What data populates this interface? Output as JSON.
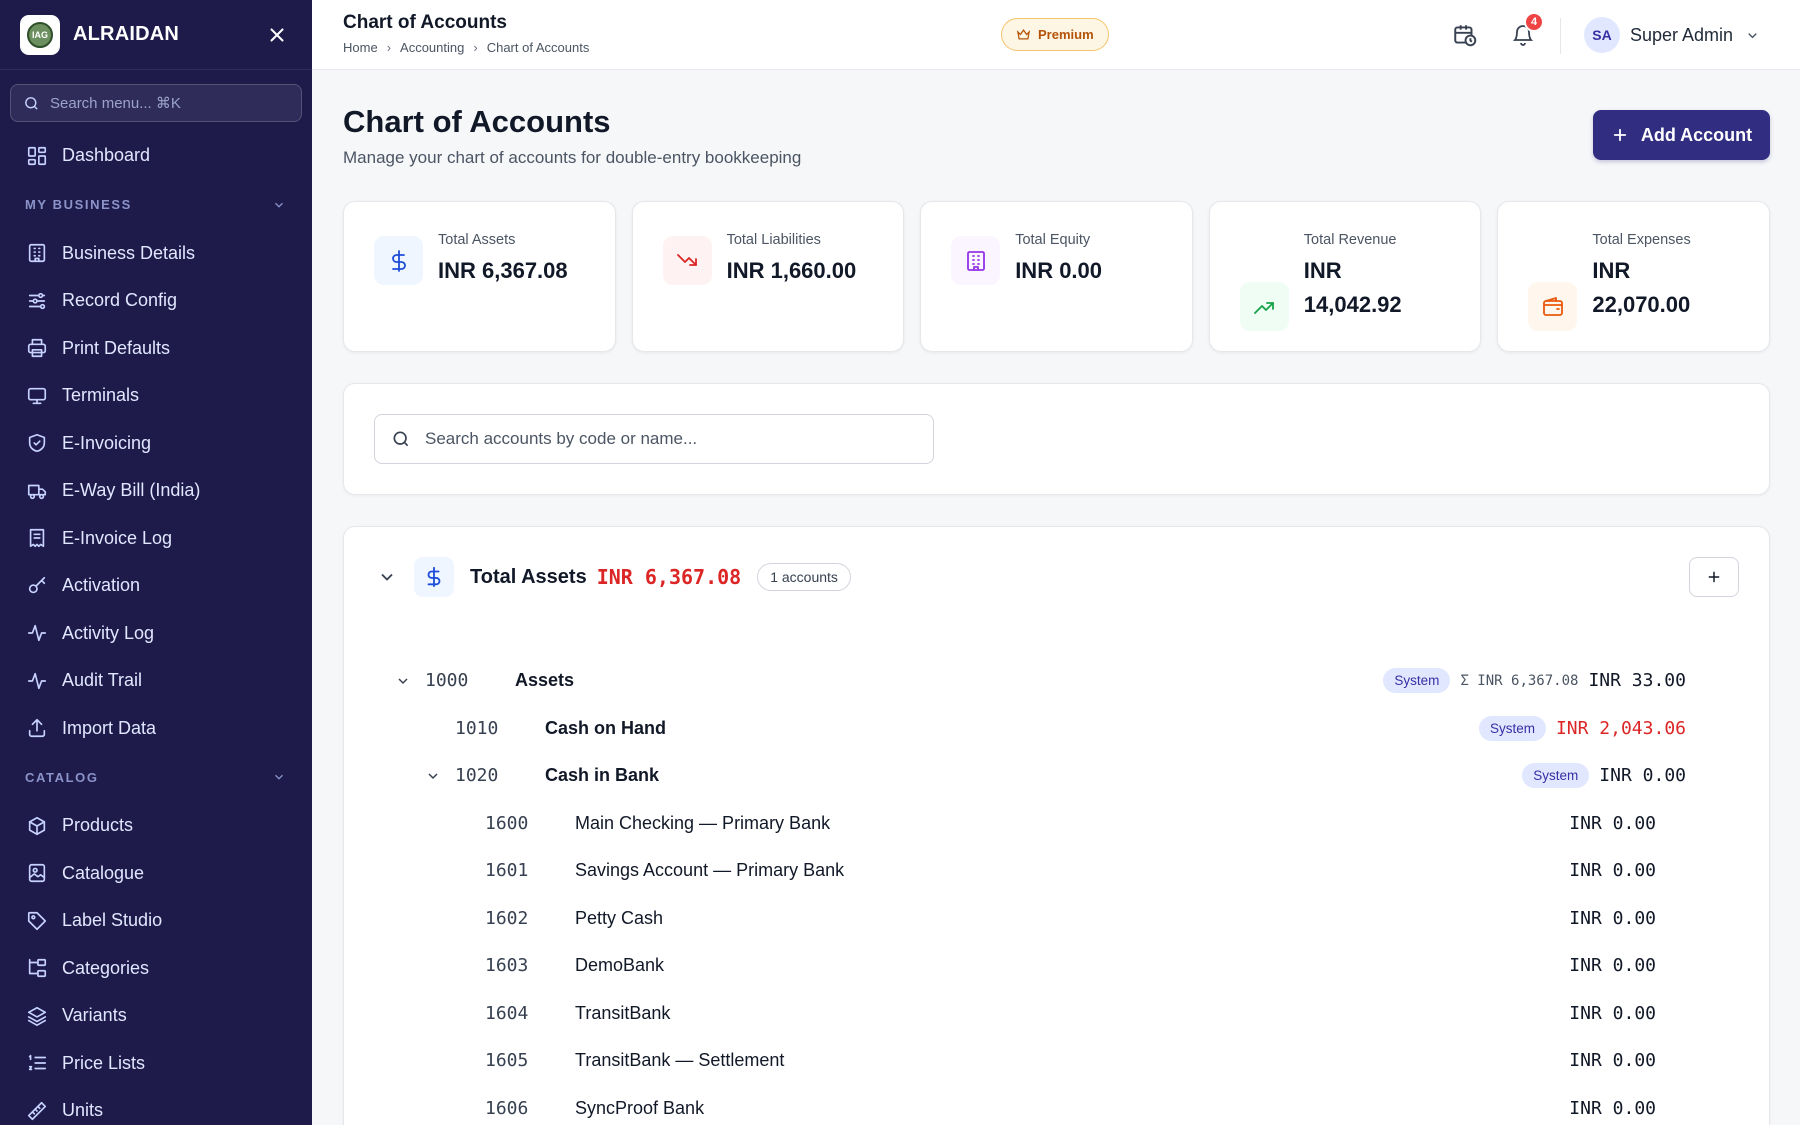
{
  "brand": {
    "name": "ALRAIDAN",
    "logo_text": "IAG"
  },
  "sidebar": {
    "search_placeholder": "Search menu... ⌘K",
    "dashboard": "Dashboard",
    "section_business": "MY BUSINESS",
    "business_items": [
      {
        "label": "Business Details",
        "icon": "building-icon"
      },
      {
        "label": "Record Config",
        "icon": "sliders-icon"
      },
      {
        "label": "Print Defaults",
        "icon": "printer-icon"
      },
      {
        "label": "Terminals",
        "icon": "monitor-icon"
      },
      {
        "label": "E-Invoicing",
        "icon": "shield-check-icon"
      },
      {
        "label": "E-Way Bill (India)",
        "icon": "truck-icon"
      },
      {
        "label": "E-Invoice Log",
        "icon": "receipt-icon"
      },
      {
        "label": "Activation",
        "icon": "key-icon"
      },
      {
        "label": "Activity Log",
        "icon": "activity-icon"
      },
      {
        "label": "Audit Trail",
        "icon": "activity-icon"
      },
      {
        "label": "Import Data",
        "icon": "upload-icon"
      }
    ],
    "section_catalog": "CATALOG",
    "catalog_items": [
      {
        "label": "Products",
        "icon": "package-icon"
      },
      {
        "label": "Catalogue",
        "icon": "book-image-icon"
      },
      {
        "label": "Label Studio",
        "icon": "tag-icon"
      },
      {
        "label": "Categories",
        "icon": "folder-tree-icon"
      },
      {
        "label": "Variants",
        "icon": "layers-icon"
      },
      {
        "label": "Price Lists",
        "icon": "list-ordered-icon"
      },
      {
        "label": "Units",
        "icon": "ruler-icon"
      }
    ]
  },
  "header": {
    "title": "Chart of Accounts",
    "breadcrumbs": [
      "Home",
      "Accounting",
      "Chart of Accounts"
    ],
    "premium_label": "Premium",
    "notification_count": "4",
    "user_initials": "SA",
    "user_name": "Super Admin"
  },
  "page": {
    "title": "Chart of Accounts",
    "subtitle": "Manage your chart of accounts for double-entry bookkeeping",
    "add_button": "Add Account"
  },
  "stats": [
    {
      "label": "Total Assets",
      "value": "INR 6,367.08",
      "icon": "dollar-icon",
      "color": "#1d4ed8",
      "bg": "#eff6ff"
    },
    {
      "label": "Total Liabilities",
      "value": "INR 1,660.00",
      "icon": "trending-down-icon",
      "color": "#dc2626",
      "bg": "#fef2f2"
    },
    {
      "label": "Total Equity",
      "value": "INR 0.00",
      "icon": "building-icon",
      "color": "#9333ea",
      "bg": "#faf5ff"
    },
    {
      "label": "Total Revenue",
      "value": "INR 14,042.92",
      "icon": "trending-up-icon",
      "color": "#16a34a",
      "bg": "#f0fdf4"
    },
    {
      "label": "Total Expenses",
      "value": "INR 22,070.00",
      "icon": "wallet-icon",
      "color": "#ea580c",
      "bg": "#fff7ed"
    }
  ],
  "search": {
    "placeholder": "Search accounts by code or name..."
  },
  "group": {
    "title": "Total Assets",
    "total": "INR 6,367.08",
    "count_label": "1 accounts",
    "accounts": [
      {
        "code": "1000",
        "name": "Assets",
        "system": "System",
        "sigma": "Σ INR 6,367.08",
        "amount": "INR 33.00",
        "negative": false
      },
      {
        "code": "1010",
        "name": "Cash on Hand",
        "system": "System",
        "amount": "INR 2,043.06",
        "negative": true
      },
      {
        "code": "1020",
        "name": "Cash in Bank",
        "system": "System",
        "amount": "INR 0.00",
        "negative": false
      },
      {
        "code": "1600",
        "name": "Main Checking — Primary Bank",
        "amount": "INR 0.00"
      },
      {
        "code": "1601",
        "name": "Savings Account — Primary Bank",
        "amount": "INR 0.00"
      },
      {
        "code": "1602",
        "name": "Petty Cash",
        "amount": "INR 0.00"
      },
      {
        "code": "1603",
        "name": "DemoBank",
        "amount": "INR 0.00"
      },
      {
        "code": "1604",
        "name": "TransitBank",
        "amount": "INR 0.00"
      },
      {
        "code": "1605",
        "name": "TransitBank — Settlement",
        "amount": "INR 0.00"
      },
      {
        "code": "1606",
        "name": "SyncProof Bank",
        "amount": "INR 0.00"
      }
    ]
  }
}
